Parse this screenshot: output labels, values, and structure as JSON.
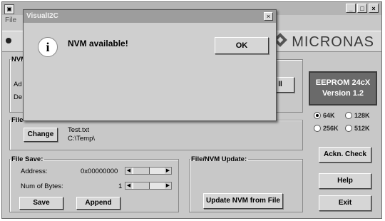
{
  "main": {
    "menu_label": "File",
    "logo_text": "MICRONAS"
  },
  "nvm_box": {
    "legend": "NVM",
    "row1_label": "Ad",
    "row2_label": "De",
    "button_partial": "ll"
  },
  "eeprom": {
    "line1": "EEPROM 24cX",
    "line2": "Version 1.2",
    "sizes": [
      "64K",
      "128K",
      "256K",
      "512K"
    ],
    "selected": "64K"
  },
  "file_box": {
    "legend": "File",
    "change_label": "Change",
    "filename": "Test.txt",
    "path": "C:\\Temp\\"
  },
  "file_save": {
    "legend": "File Save:",
    "address_label": "Address:",
    "address_value": "0x00000000",
    "bytes_label": "Num of Bytes:",
    "bytes_value": "1",
    "save_label": "Save",
    "append_label": "Append"
  },
  "nvm_update": {
    "legend": "File/NVM Update:",
    "button_label": "Update NVM from File"
  },
  "side_buttons": {
    "ackn": "Ackn. Check",
    "help": "Help",
    "exit": "Exit"
  },
  "dialog": {
    "title": "VisualI2C",
    "message": "NVM available!",
    "ok_label": "OK",
    "icon": "i"
  }
}
